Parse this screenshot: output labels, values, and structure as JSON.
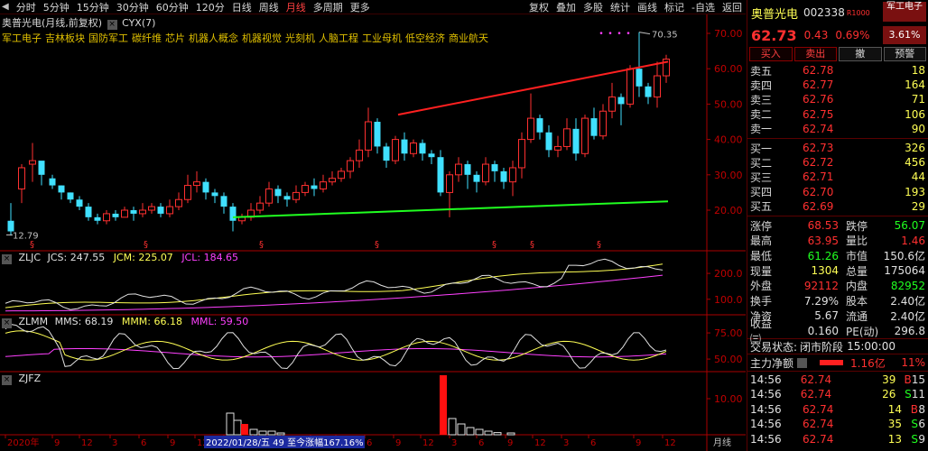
{
  "toolbar": {
    "periods": [
      "分时",
      "5分钟",
      "15分钟",
      "30分钟",
      "60分钟",
      "120分",
      "日线",
      "周线",
      "月线",
      "多周期",
      "更多"
    ],
    "active_period": "月线",
    "tools": [
      "复权",
      "叠加",
      "多股",
      "统计",
      "画线",
      "标记",
      "-自选",
      "返回"
    ]
  },
  "chart": {
    "title": "奥普光电(月线,前复权)",
    "indicator": "CYX(7)",
    "sector_tags": [
      "军工电子",
      "吉林板块",
      "国防军工",
      "碳纤维",
      "芯片",
      "机器人概念",
      "机器视觉",
      "光刻机",
      "人脑工程",
      "工业母机",
      "低空经济",
      "商业航天"
    ],
    "price_axis": [
      "70.00",
      "60.00",
      "50.00",
      "40.00",
      "30.00",
      "20.00"
    ],
    "max_label": "70.35",
    "min_label": "12.79",
    "zljc": {
      "name": "ZLJC",
      "jcs": "JCS: 247.55",
      "jcm": "JCM: 225.07",
      "jcl": "JCL: 184.65",
      "axis": [
        "200.0",
        "100.0"
      ]
    },
    "zlmm": {
      "name": "ZLMM",
      "mms": "MMS: 68.19",
      "mmm": "MMM: 66.18",
      "mml": "MML: 59.50",
      "axis": [
        "75.00",
        "50.00"
      ]
    },
    "zjfz": {
      "name": "ZJFZ",
      "axis": [
        "10.00"
      ]
    },
    "x_axis": [
      "2020年",
      "9",
      "12",
      "3",
      "6",
      "9",
      "12",
      "3",
      "6",
      "9",
      "12",
      "3",
      "6",
      "9",
      "12",
      "3",
      "6",
      "9",
      "12",
      "3",
      "6",
      "9",
      "12"
    ],
    "cursor_info": "2022/01/28/五 49 至今涨幅167.16%",
    "period_label": "月线"
  },
  "quote": {
    "name": "奥普光电",
    "code": "002338",
    "flag": "R",
    "flag_sub": "1000",
    "sector": "军工电子",
    "sector_pct": "3.61%",
    "price": "62.73",
    "change": "0.43",
    "change_pct": "0.69%",
    "buttons": [
      "买入",
      "卖出",
      "撤",
      "预警"
    ],
    "asks": [
      {
        "label": "卖五",
        "price": "62.78",
        "vol": "18"
      },
      {
        "label": "卖四",
        "price": "62.77",
        "vol": "164"
      },
      {
        "label": "卖三",
        "price": "62.76",
        "vol": "71"
      },
      {
        "label": "卖二",
        "price": "62.75",
        "vol": "106"
      },
      {
        "label": "卖一",
        "price": "62.74",
        "vol": "90"
      }
    ],
    "bids": [
      {
        "label": "买一",
        "price": "62.73",
        "vol": "326"
      },
      {
        "label": "买二",
        "price": "62.72",
        "vol": "456"
      },
      {
        "label": "买三",
        "price": "62.71",
        "vol": "44"
      },
      {
        "label": "买四",
        "price": "62.70",
        "vol": "193"
      },
      {
        "label": "买五",
        "price": "62.69",
        "vol": "29"
      }
    ],
    "stats": [
      {
        "k": "涨停",
        "v": "68.53",
        "vc": "red",
        "k2": "跌停",
        "v2": "56.07",
        "v2c": "green"
      },
      {
        "k": "最高",
        "v": "63.95",
        "vc": "red",
        "k2": "量比",
        "v2": "1.46",
        "v2c": "red"
      },
      {
        "k": "最低",
        "v": "61.26",
        "vc": "green",
        "k2": "市值",
        "v2": "150.6亿",
        "v2c": "white"
      },
      {
        "k": "现量",
        "v": "1304",
        "vc": "yellow",
        "k2": "总量",
        "v2": "175064",
        "v2c": "white"
      },
      {
        "k": "外盘",
        "v": "92112",
        "vc": "red",
        "k2": "内盘",
        "v2": "82952",
        "v2c": "green"
      },
      {
        "k": "换手",
        "v": "7.29%",
        "vc": "white",
        "k2": "股本",
        "v2": "2.40亿",
        "v2c": "white"
      },
      {
        "k": "净资",
        "v": "5.67",
        "vc": "white",
        "k2": "流通",
        "v2": "2.40亿",
        "v2c": "white"
      },
      {
        "k": "收益㈢",
        "v": "0.160",
        "vc": "white",
        "k2": "PE(动)",
        "v2": "296.8",
        "v2c": "white"
      }
    ],
    "trade_state_label": "交易状态:",
    "trade_state": "闭市阶段",
    "trade_time": "15:00:00",
    "main_flow_label": "主力净额",
    "main_flow_value": "1.16亿",
    "main_flow_pct": "11%",
    "ticks": [
      {
        "t": "14:56",
        "p": "62.74",
        "q": "39",
        "s": "B",
        "sc": "red",
        "n": "15"
      },
      {
        "t": "14:56",
        "p": "62.74",
        "q": "26",
        "s": "S",
        "sc": "green",
        "n": "11"
      },
      {
        "t": "14:56",
        "p": "62.74",
        "q": "14",
        "s": "B",
        "sc": "red",
        "n": "8"
      },
      {
        "t": "14:56",
        "p": "62.74",
        "q": "35",
        "s": "S",
        "sc": "green",
        "n": "6"
      },
      {
        "t": "14:56",
        "p": "62.74",
        "q": "13",
        "s": "S",
        "sc": "green",
        "n": "9"
      }
    ]
  }
}
